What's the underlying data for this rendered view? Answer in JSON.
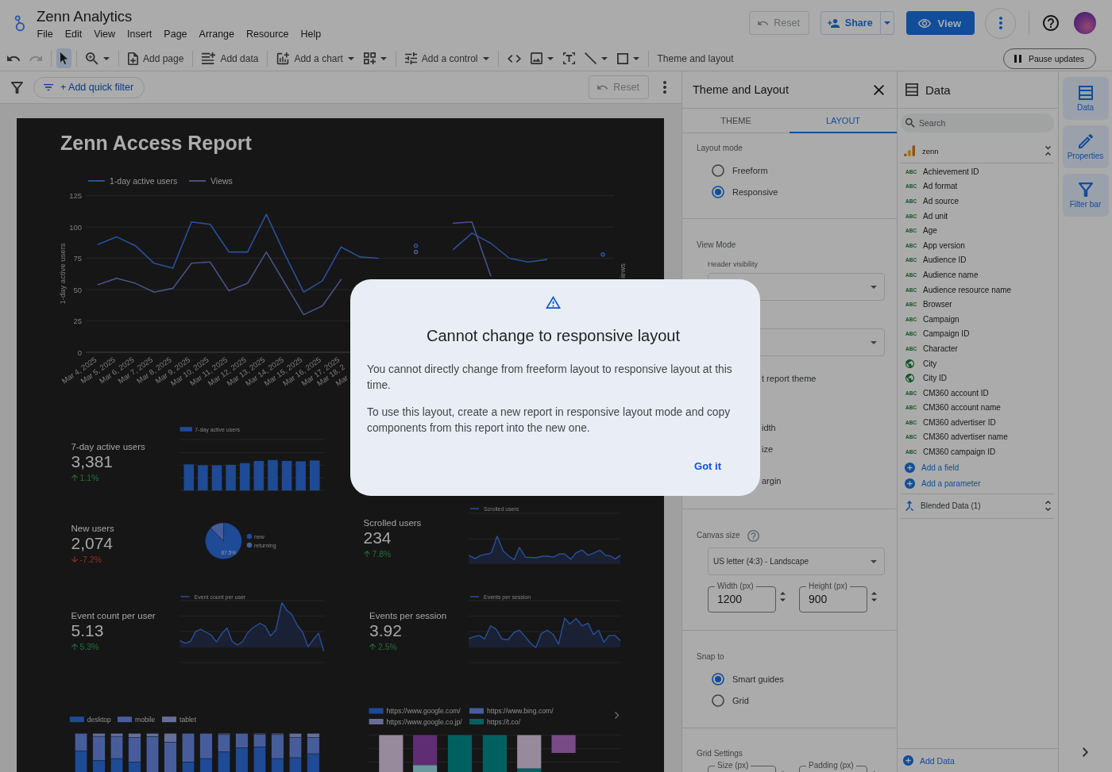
{
  "header": {
    "app_title": "Zenn Analytics",
    "menu": [
      "File",
      "Edit",
      "View",
      "Insert",
      "Page",
      "Arrange",
      "Resource",
      "Help"
    ],
    "actions": [
      {
        "kind": "reset",
        "label": "Reset",
        "disabled": true
      },
      {
        "kind": "share",
        "label": "Share"
      },
      {
        "kind": "view",
        "label": "View"
      },
      {
        "kind": "more"
      },
      {
        "kind": "help"
      },
      {
        "kind": "avatar"
      }
    ]
  },
  "toolbar": {
    "groups": [
      [
        {
          "kind": "undo",
          "selected": false,
          "disabled": false,
          "dropdown": false
        },
        {
          "kind": "redo",
          "selected": false,
          "disabled": true,
          "dropdown": false
        }
      ],
      [
        {
          "kind": "select",
          "selected": true,
          "disabled": false,
          "dropdown": false
        }
      ],
      [
        {
          "kind": "zoom",
          "selected": false,
          "disabled": false,
          "dropdown": true
        }
      ],
      [
        {
          "kind": "add_page",
          "label": "Add page",
          "selected": false,
          "disabled": false,
          "dropdown": false
        }
      ],
      [
        {
          "kind": "add_data",
          "label": "Add data",
          "selected": false,
          "disabled": false,
          "dropdown": false
        }
      ],
      [
        {
          "kind": "add_chart",
          "label": "Add a chart",
          "selected": false,
          "disabled": false,
          "dropdown": true
        },
        {
          "kind": "community",
          "selected": false,
          "disabled": false,
          "dropdown": true
        }
      ],
      [
        {
          "kind": "add_control",
          "label": "Add a control",
          "selected": false,
          "disabled": false,
          "dropdown": true
        }
      ],
      [
        {
          "kind": "code",
          "selected": false,
          "disabled": false,
          "dropdown": false
        },
        {
          "kind": "image",
          "selected": false,
          "disabled": false,
          "dropdown": true
        },
        {
          "kind": "text",
          "selected": false,
          "disabled": false,
          "dropdown": false
        },
        {
          "kind": "line",
          "selected": false,
          "disabled": false,
          "dropdown": true
        },
        {
          "kind": "shape",
          "selected": false,
          "disabled": false,
          "dropdown": true
        }
      ],
      [
        {
          "kind": "theme",
          "label": "Theme and layout",
          "selected": false,
          "disabled": false,
          "dropdown": false
        }
      ]
    ],
    "pause": "Pause updates"
  },
  "filter_bar": {
    "add_filter": "+ Add quick filter",
    "reset": {
      "label": "Reset",
      "disabled": true
    }
  },
  "report": {
    "title": "Zenn Access Report",
    "line_chart": {
      "right_axis_title": "iews",
      "cut_tick_labels": [
        "Mar 18, 2",
        "Mar"
      ],
      "chart_data": {
        "type": "line",
        "legend": "top",
        "grid": true,
        "ylabel": "1-day active users",
        "categories": [
          "Mar 4, 2025",
          "Mar 5, 2025",
          "Mar 6, 2025",
          "Mar 7, 2025",
          "Mar 8, 2025",
          "Mar 9, 2025",
          "Mar 10, 2025",
          "Mar 11, 2025",
          "Mar 12, 2025",
          "Mar 13, 2025",
          "Mar 14, 2025",
          "Mar 15, 2025",
          "Mar 16, 2025",
          "Mar 17, 2025",
          null,
          null,
          null,
          null,
          null,
          null,
          null,
          null,
          null,
          null,
          null,
          null,
          null,
          null
        ],
        "ylim": [
          0,
          125
        ],
        "yticks": [
          0,
          25,
          50,
          75,
          100,
          125
        ],
        "series": [
          {
            "name": "1-day active users",
            "color": "#28509b",
            "values": [
              86,
              92,
              85,
              71,
              67,
              104,
              102,
              80,
              80,
              110,
              78,
              48,
              57,
              84,
              76,
              75,
              null,
              85,
              null,
              82,
              95,
              87,
              75,
              72,
              74,
              null,
              null,
              78
            ]
          },
          {
            "name": "Views",
            "color": "#4a5287",
            "values": [
              54,
              59,
              55,
              48,
              51,
              71,
              72,
              49,
              55,
              80,
              55,
              30,
              37,
              58,
              null,
              null,
              null,
              80,
              null,
              103,
              104,
              61,
              null,
              null,
              null,
              null,
              null,
              null
            ]
          }
        ]
      }
    },
    "scorecards": [
      {
        "label": "7-day active users",
        "value": "3,381",
        "change": "1.1%",
        "increase": true,
        "chart": {
          "kind": "bars",
          "legend": "7-day active users"
        }
      },
      {
        "label": "New users",
        "value": "2,074",
        "change": "-7.2%",
        "increase": false,
        "chart": {
          "kind": "pie",
          "chart_data": {
            "type": "pie",
            "legend": "right",
            "categories": [
              "new",
              "returning"
            ],
            "values": [
              87.5,
              12.5
            ],
            "colors": [
              "#1e4a96",
              "#475d9b"
            ],
            "value_labels": [
              "87.5%",
              null
            ]
          }
        }
      },
      {
        "label": "Scrolled users",
        "value": "234",
        "change": "7.8%",
        "increase": true,
        "chart": {
          "kind": "line",
          "legend": "Scrolled users"
        }
      },
      {
        "label": "Event count per user",
        "value": "5.13",
        "change": "5.3%",
        "increase": true,
        "chart": {
          "kind": "line",
          "legend": "Event count per user"
        }
      },
      {
        "label": "Events per session",
        "value": "3.92",
        "change": "2.5%",
        "increase": true,
        "chart": {
          "kind": "line",
          "legend": "Events per session"
        }
      }
    ],
    "device_chart": {
      "legend": [
        {
          "name": "desktop",
          "color": "#1e4a96"
        },
        {
          "name": "mobile",
          "color": "#475d9b"
        },
        {
          "name": "tablet",
          "color": "#646f9a"
        }
      ]
    },
    "referrer_chart": {
      "legend": [
        {
          "name": "https://www.google.com/",
          "color": "#1e4a96"
        },
        {
          "name": "https://www.bing.com/",
          "color": "#475d9b"
        },
        {
          "name": "https://www.google.co.jp/",
          "color": "#676d96"
        },
        {
          "name": "https://t.co/",
          "color": "#006060"
        }
      ]
    }
  },
  "theme_panel": {
    "title": "Theme and Layout",
    "tabs": [
      {
        "label": "THEME",
        "selected": false
      },
      {
        "label": "LAYOUT",
        "selected": true
      }
    ],
    "sections": [
      {
        "title": "Layout mode",
        "help": false,
        "items": [
          {
            "kind": "radio",
            "label": "Freeform",
            "selected": false
          },
          {
            "kind": "radio",
            "label": "Responsive",
            "selected": true
          }
        ]
      },
      {
        "title": "View Mode",
        "help": false,
        "items": [
          {
            "kind": "dropdown",
            "label": "Header visibility"
          },
          {
            "kind": "dropdown"
          },
          {
            "kind": "fragment",
            "text": "t report theme"
          },
          {
            "kind": "fragment",
            "text": "idth"
          },
          {
            "kind": "fragment",
            "text": "ize"
          },
          {
            "kind": "fragment",
            "text": "argin"
          }
        ]
      },
      {
        "title": "Canvas size",
        "help": true,
        "items": [
          {
            "kind": "dropdown",
            "value": "US letter (4:3) - Landscape"
          },
          {
            "kind": "number_pair",
            "fields": [
              {
                "label": "Width (px)",
                "value": "1200"
              },
              {
                "label": "Height (px)",
                "value": "900"
              }
            ]
          }
        ]
      },
      {
        "title": "Snap to",
        "help": false,
        "items": [
          {
            "kind": "radio",
            "label": "Smart guides",
            "selected": true
          },
          {
            "kind": "radio",
            "label": "Grid",
            "selected": false
          }
        ]
      },
      {
        "title": "Grid Settings",
        "help": false,
        "items": [
          {
            "kind": "number_pair",
            "fields": [
              {
                "label": "Size (px)"
              },
              {
                "label": "Padding (px)"
              }
            ]
          }
        ]
      }
    ]
  },
  "data_panel": {
    "title": "Data",
    "search": {
      "placeholder": "Search"
    },
    "source": {
      "name": "zenn",
      "expanded": true,
      "fields": [
        {
          "kind": "text",
          "type_label": "ABC",
          "name": "Achievement ID"
        },
        {
          "kind": "text",
          "type_label": "ABC",
          "name": "Ad format"
        },
        {
          "kind": "text",
          "type_label": "ABC",
          "name": "Ad source"
        },
        {
          "kind": "text",
          "type_label": "ABC",
          "name": "Ad unit"
        },
        {
          "kind": "text",
          "type_label": "ABC",
          "name": "Age"
        },
        {
          "kind": "text",
          "type_label": "ABC",
          "name": "App version"
        },
        {
          "kind": "text",
          "type_label": "ABC",
          "name": "Audience ID"
        },
        {
          "kind": "text",
          "type_label": "ABC",
          "name": "Audience name"
        },
        {
          "kind": "text",
          "type_label": "ABC",
          "name": "Audience resource name"
        },
        {
          "kind": "text",
          "type_label": "ABC",
          "name": "Browser"
        },
        {
          "kind": "text",
          "type_label": "ABC",
          "name": "Campaign"
        },
        {
          "kind": "text",
          "type_label": "ABC",
          "name": "Campaign ID"
        },
        {
          "kind": "text",
          "type_label": "ABC",
          "name": "Character"
        },
        {
          "kind": "geo",
          "name": "City"
        },
        {
          "kind": "geo",
          "name": "City ID"
        },
        {
          "kind": "text",
          "type_label": "ABC",
          "name": "CM360 account ID"
        },
        {
          "kind": "text",
          "type_label": "ABC",
          "name": "CM360 account name"
        },
        {
          "kind": "text",
          "type_label": "ABC",
          "name": "CM360 advertiser ID"
        },
        {
          "kind": "text",
          "type_label": "ABC",
          "name": "CM360 advertiser name"
        },
        {
          "kind": "text",
          "type_label": "ABC",
          "name": "CM360 campaign ID"
        }
      ]
    },
    "actions": [
      "Add a field",
      "Add a parameter"
    ],
    "blend": {
      "name": "Blended Data (1)",
      "expanded": false
    },
    "add_data": "Add Data"
  },
  "rail": [
    {
      "kind": "data",
      "label": "Data",
      "selected": true
    },
    {
      "kind": "properties",
      "label": "Properties",
      "selected": true
    },
    {
      "kind": "filter_bar",
      "label": "Filter bar",
      "selected": true
    }
  ],
  "dialog": {
    "title": "Cannot change to responsive layout",
    "paragraphs": [
      "You cannot directly change from freeform layout to responsive layout at this time.",
      "To use this layout, create a new report in responsive layout mode and copy components from this report into the new one."
    ],
    "button": "Got it"
  }
}
